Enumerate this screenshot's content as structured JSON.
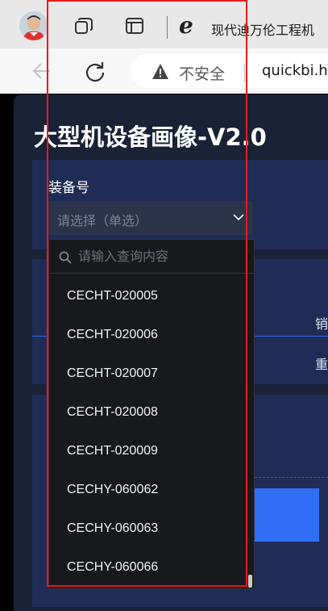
{
  "browser": {
    "tab_title": "现代迪万伦工程机",
    "tab_icons": [
      "profile-avatar",
      "collections-icon",
      "tab-actions-icon",
      "ie-mode-icon"
    ],
    "security_label": "不安全",
    "url": "quickbi.h"
  },
  "dashboard": {
    "title": "大型机设备画像-V2.0",
    "filter": {
      "label": "装备号",
      "placeholder": "请选择（单选）"
    },
    "partial_labels": [
      "销",
      "重"
    ]
  },
  "dropdown": {
    "search_placeholder": "请输入查询内容",
    "options": [
      "CECHT-020005",
      "CECHT-020006",
      "CECHT-020007",
      "CECHT-020008",
      "CECHT-020009",
      "CECHY-060062",
      "CECHY-060063",
      "CECHY-060066"
    ]
  },
  "colors": {
    "highlight": "#e8191c",
    "accent_bar": "#2f6ef5",
    "page_bg": "#1a2237",
    "panel_bg": "#1f2c55"
  }
}
